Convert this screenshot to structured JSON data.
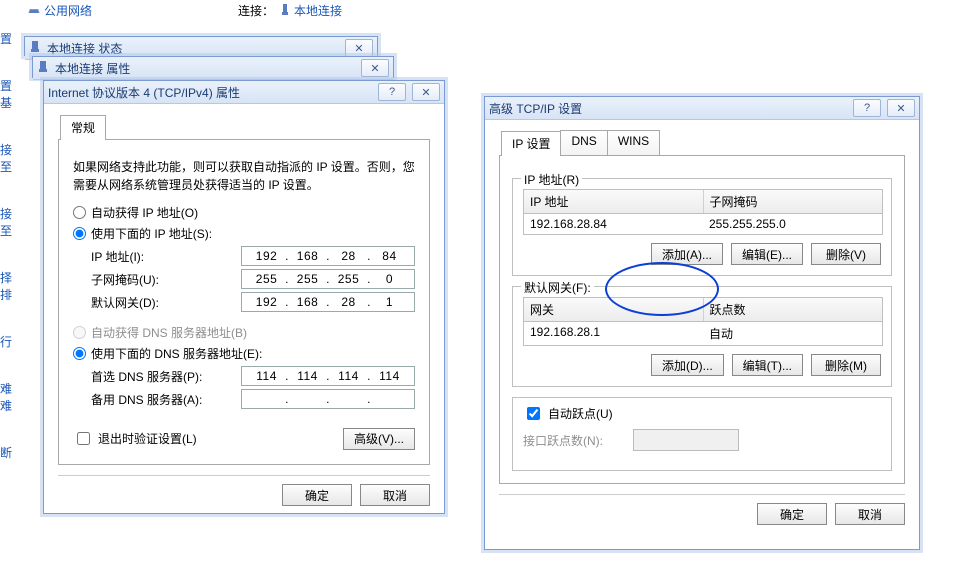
{
  "topbar": {
    "network_type": "公用网络",
    "connect_label": "连接：",
    "connection_name": "本地连接"
  },
  "sidebar": {
    "items": [
      "置",
      "置基",
      "接至",
      "接至",
      "择排",
      "行",
      "难难",
      "断"
    ]
  },
  "win_status": {
    "title": "本地连接 状态"
  },
  "win_props": {
    "title": "本地连接 属性"
  },
  "win_ipv4": {
    "title": "Internet 协议版本 4 (TCP/IPv4) 属性",
    "tab_general": "常规",
    "info": "如果网络支持此功能，则可以获取自动指派的 IP 设置。否则，您需要从网络系统管理员处获得适当的 IP 设置。",
    "radio_auto_ip": "自动获得 IP 地址(O)",
    "radio_use_ip": "使用下面的 IP 地址(S):",
    "label_ip": "IP 地址(I):",
    "label_mask": "子网掩码(U):",
    "label_gw": "默认网关(D):",
    "ip": [
      "192",
      "168",
      "28",
      "84"
    ],
    "mask": [
      "255",
      "255",
      "255",
      "0"
    ],
    "gw": [
      "192",
      "168",
      "28",
      "1"
    ],
    "radio_auto_dns": "自动获得 DNS 服务器地址(B)",
    "radio_use_dns": "使用下面的 DNS 服务器地址(E):",
    "label_dns1": "首选 DNS 服务器(P):",
    "label_dns2": "备用 DNS 服务器(A):",
    "dns1": [
      "114",
      "114",
      "114",
      "114"
    ],
    "dns2": [
      "",
      "",
      "",
      ""
    ],
    "check_validate": "退出时验证设置(L)",
    "btn_advanced": "高级(V)...",
    "btn_ok": "确定",
    "btn_cancel": "取消"
  },
  "win_adv": {
    "title": "高级 TCP/IP 设置",
    "tab_ip": "IP 设置",
    "tab_dns": "DNS",
    "tab_wins": "WINS",
    "group_ip": "IP 地址(R)",
    "col_ip": "IP 地址",
    "col_mask": "子网掩码",
    "row_ip": "192.168.28.84",
    "row_mask": "255.255.255.0",
    "btn_add_a": "添加(A)...",
    "btn_edit_e": "编辑(E)...",
    "btn_del_v": "删除(V)",
    "group_gw": "默认网关(F):",
    "col_gw": "网关",
    "col_metric": "跃点数",
    "row_gw": "192.168.28.1",
    "row_metric": "自动",
    "btn_add_d": "添加(D)...",
    "btn_edit_t": "编辑(T)...",
    "btn_del_m": "删除(M)",
    "check_autometric": "自动跃点(U)",
    "label_ifmetric": "接口跃点数(N):",
    "btn_ok": "确定",
    "btn_cancel": "取消"
  }
}
